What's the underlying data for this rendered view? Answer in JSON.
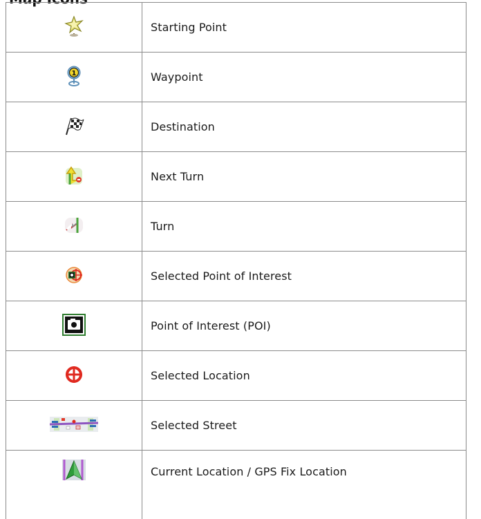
{
  "heading": "Map Icons",
  "rows": [
    {
      "icon": "starting-point-star-icon",
      "label": "Starting Point"
    },
    {
      "icon": "waypoint-pin-icon",
      "label": "Waypoint"
    },
    {
      "icon": "checkered-flag-icon",
      "label": "Destination"
    },
    {
      "icon": "next-turn-icon",
      "label": "Next Turn"
    },
    {
      "icon": "turn-arrow-icon",
      "label": "Turn"
    },
    {
      "icon": "selected-poi-icon",
      "label": "Selected Point of Interest"
    },
    {
      "icon": "poi-camera-icon",
      "label": "Point of Interest (POI)"
    },
    {
      "icon": "crosshair-target-icon",
      "label": "Selected Location"
    },
    {
      "icon": "selected-street-icon",
      "label": "Selected Street"
    },
    {
      "icon": "gps-location-arrow-icon",
      "label": "Current Location / GPS Fix Location"
    }
  ],
  "colors": {
    "border": "#8a8a8a",
    "target_red": "#e02a20",
    "poi_green": "#2f7d2f"
  }
}
